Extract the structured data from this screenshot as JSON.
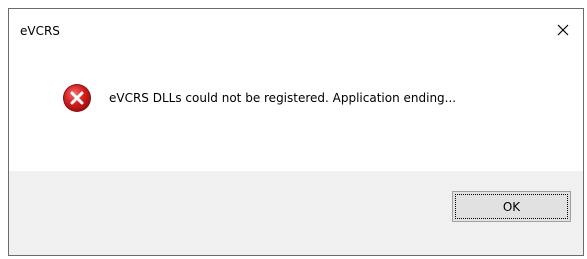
{
  "window": {
    "title": "eVCRS",
    "close_icon": "close-icon"
  },
  "dialog": {
    "icon": "error-icon",
    "message": "eVCRS DLLs could not be registered.  Application ending...",
    "ok_label": "OK"
  },
  "colors": {
    "icon_red": "#d21f1f",
    "footer_bg": "#f0f0f0",
    "button_bg": "#e1e1e1"
  }
}
